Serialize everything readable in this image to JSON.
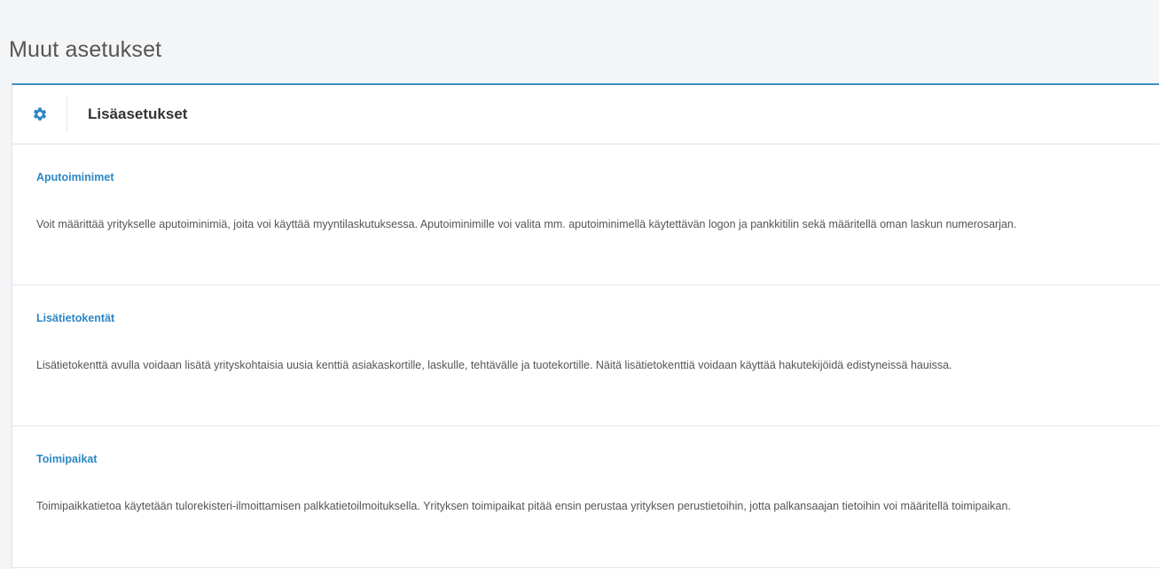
{
  "page": {
    "title": "Muut asetukset"
  },
  "panel": {
    "icon": "gear-icon",
    "title": "Lisäasetukset",
    "accent_color": "#3a8fc4",
    "link_color": "#2b87c3"
  },
  "sections": [
    {
      "link": "Aputoiminimet",
      "description": "Voit määrittää yritykselle aputoiminimiä, joita voi käyttää myyntilaskutuksessa. Aputoiminimille voi valita mm. aputoiminimellä käytettävän logon ja pankkitilin sekä määritellä oman laskun numerosarjan."
    },
    {
      "link": "Lisätietokentät",
      "description": "Lisätietokenttä avulla voidaan lisätä yrityskohtaisia uusia kenttiä asiakaskortille, laskulle, tehtävälle ja tuotekortille. Näitä lisätietokenttiä voidaan käyttää hakutekijöidä edistyneissä hauissa."
    },
    {
      "link": "Toimipaikat",
      "description": "Toimipaikkatietoa käytetään tulorekisteri-ilmoittamisen palkkatietoilmoituksella. Yrityksen toimipaikat pitää ensin perustaa yrityksen perustietoihin, jotta palkansaajan tietoihin voi määritellä toimipaikan."
    }
  ]
}
